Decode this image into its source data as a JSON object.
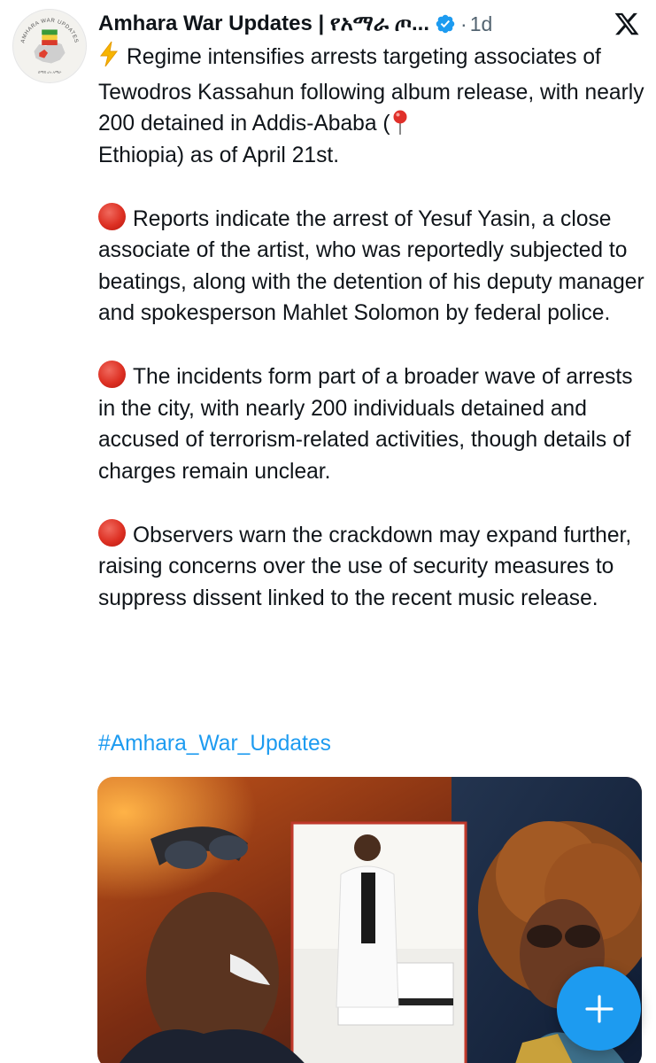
{
  "author": {
    "display_name": "Amhara War Updates | የአማራ ጦ...",
    "avatar_label": "AMHARA WAR UPDATES",
    "verified": true,
    "time_separator": "·",
    "timestamp": "1d"
  },
  "tweet": {
    "paragraphs": [
      {
        "emoji": "lightning-icon",
        "text_before_pin": "Regime intensifies arrests targeting associates of Tewodros Kassahun following album release, with nearly 200 detained in Addis-Ababa (",
        "text_after_pin": "Ethiopia) as of April 21st."
      },
      {
        "emoji": "red-circle-icon",
        "text": "Reports indicate the arrest of Yesuf Yasin, a close associate of the artist, who was reportedly subjected to beatings, along with the detention of his deputy manager and spokesperson Mahlet Solomon by federal police."
      },
      {
        "emoji": "red-circle-icon",
        "text": "The incidents form part of a broader wave of arrests in the city, with nearly 200 individuals detained and accused of terrorism-related activities, though details of charges remain unclear."
      },
      {
        "emoji": "red-circle-icon",
        "text": "Observers warn the crackdown may expand further, raising concerns over the use of security measures to suppress dissent linked to the recent music release."
      }
    ],
    "hashtag": "#Amhara_War_Updates"
  },
  "colors": {
    "link": "#1d9bf0",
    "secondary_text": "#536471",
    "fab": "#1d9bf0",
    "verified_badge": "#1d9bf0"
  },
  "icons": {
    "platform": "x-logo-icon",
    "compose": "plus-icon"
  }
}
